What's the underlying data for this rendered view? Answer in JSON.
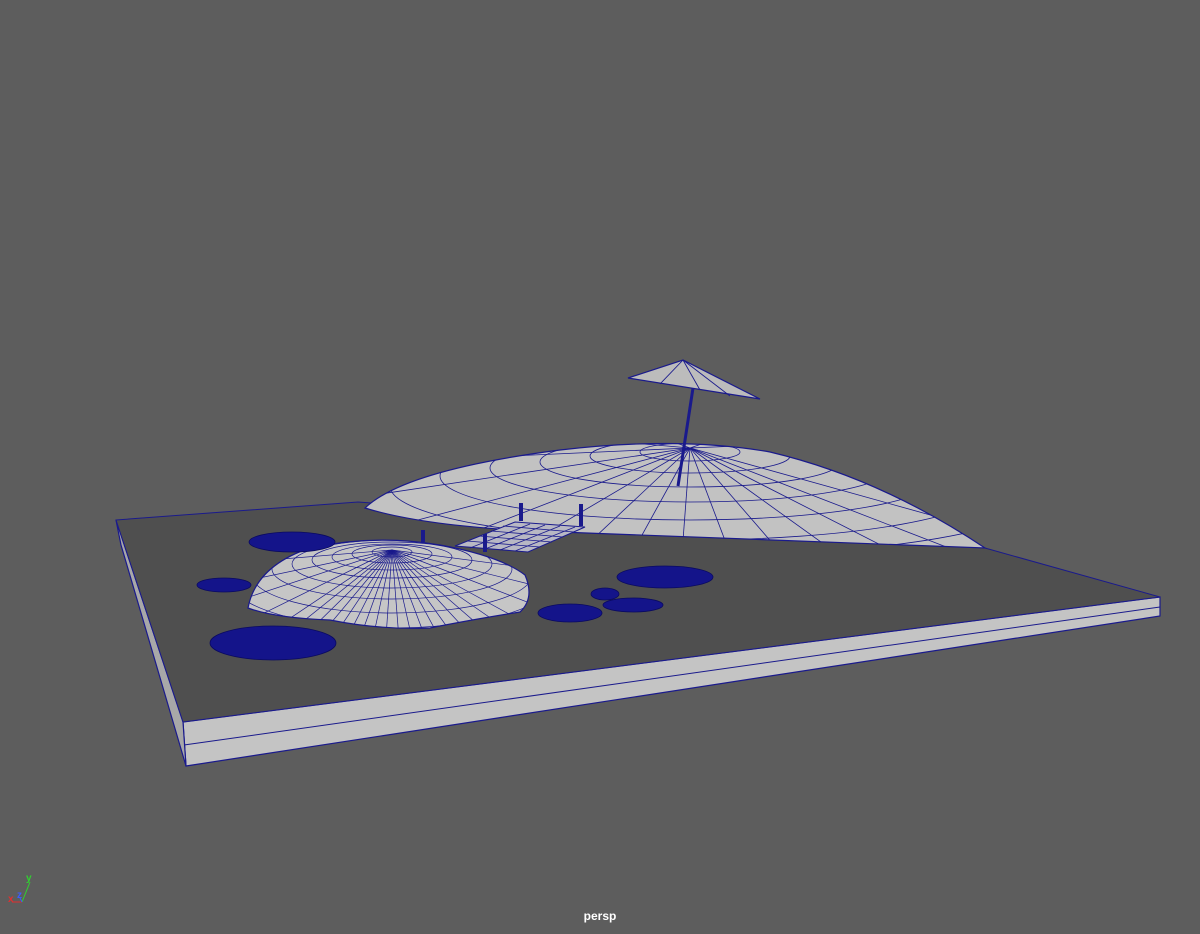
{
  "viewport": {
    "camera_label": "persp",
    "background_color": "#5d5d5d",
    "wireframe_color": "#1a1a8c"
  },
  "axis_gizmo": {
    "x_label": "x",
    "y_label": "y",
    "z_label": "z",
    "x_color": "#e03030",
    "y_color": "#30d030",
    "z_color": "#3a5cff"
  },
  "scene": {
    "objects": [
      "ground-slab",
      "large-mound",
      "small-mound",
      "bridge",
      "umbrella",
      "lily-pads"
    ]
  }
}
